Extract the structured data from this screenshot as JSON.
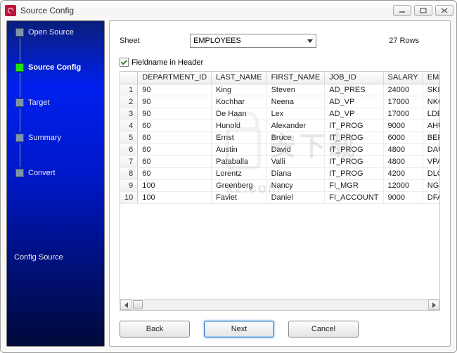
{
  "window": {
    "title": "Source Config"
  },
  "sidebar": {
    "steps": [
      {
        "label": "Open Source",
        "active": false
      },
      {
        "label": "Source Config",
        "active": true
      },
      {
        "label": "Target",
        "active": false
      },
      {
        "label": "Summary",
        "active": false
      },
      {
        "label": "Convert",
        "active": false
      }
    ],
    "status": "Config Source"
  },
  "config": {
    "sheet_label": "Sheet",
    "sheet_value": "EMPLOYEES",
    "rows_info": "27 Rows",
    "fieldname_checkbox_label": "Fieldname in Header",
    "fieldname_checked": true
  },
  "table": {
    "columns": [
      "DEPARTMENT_ID",
      "LAST_NAME",
      "FIRST_NAME",
      "JOB_ID",
      "SALARY",
      "EMAIL"
    ],
    "rows": [
      {
        "n": "1",
        "DEPARTMENT_ID": "90",
        "LAST_NAME": "King",
        "FIRST_NAME": "Steven",
        "JOB_ID": "AD_PRES",
        "SALARY": "24000",
        "EMAIL": "SKING"
      },
      {
        "n": "2",
        "DEPARTMENT_ID": "90",
        "LAST_NAME": "Kochhar",
        "FIRST_NAME": "Neena",
        "JOB_ID": "AD_VP",
        "SALARY": "17000",
        "EMAIL": "NKOCHHAR"
      },
      {
        "n": "3",
        "DEPARTMENT_ID": "90",
        "LAST_NAME": "De Haan",
        "FIRST_NAME": "Lex",
        "JOB_ID": "AD_VP",
        "SALARY": "17000",
        "EMAIL": "LDEHAAN"
      },
      {
        "n": "4",
        "DEPARTMENT_ID": "60",
        "LAST_NAME": "Hunold",
        "FIRST_NAME": "Alexander",
        "JOB_ID": "IT_PROG",
        "SALARY": "9000",
        "EMAIL": "AHUNOLD"
      },
      {
        "n": "5",
        "DEPARTMENT_ID": "60",
        "LAST_NAME": "Ernst",
        "FIRST_NAME": "Bruce",
        "JOB_ID": "IT_PROG",
        "SALARY": "6000",
        "EMAIL": "BERNST"
      },
      {
        "n": "6",
        "DEPARTMENT_ID": "60",
        "LAST_NAME": "Austin",
        "FIRST_NAME": "David",
        "JOB_ID": "IT_PROG",
        "SALARY": "4800",
        "EMAIL": "DAUSTIN"
      },
      {
        "n": "7",
        "DEPARTMENT_ID": "60",
        "LAST_NAME": "Pataballa",
        "FIRST_NAME": "Valli",
        "JOB_ID": "IT_PROG",
        "SALARY": "4800",
        "EMAIL": "VPATABAL"
      },
      {
        "n": "8",
        "DEPARTMENT_ID": "60",
        "LAST_NAME": "Lorentz",
        "FIRST_NAME": "Diana",
        "JOB_ID": "IT_PROG",
        "SALARY": "4200",
        "EMAIL": "DLORENTZ"
      },
      {
        "n": "9",
        "DEPARTMENT_ID": "100",
        "LAST_NAME": "Greenberg",
        "FIRST_NAME": "Nancy",
        "JOB_ID": "FI_MGR",
        "SALARY": "12000",
        "EMAIL": "NGREENBE"
      },
      {
        "n": "10",
        "DEPARTMENT_ID": "100",
        "LAST_NAME": "Faviet",
        "FIRST_NAME": "Daniel",
        "JOB_ID": "FI_ACCOUNT",
        "SALARY": "9000",
        "EMAIL": "DFAVIET"
      }
    ]
  },
  "buttons": {
    "back": "Back",
    "next": "Next",
    "cancel": "Cancel"
  }
}
